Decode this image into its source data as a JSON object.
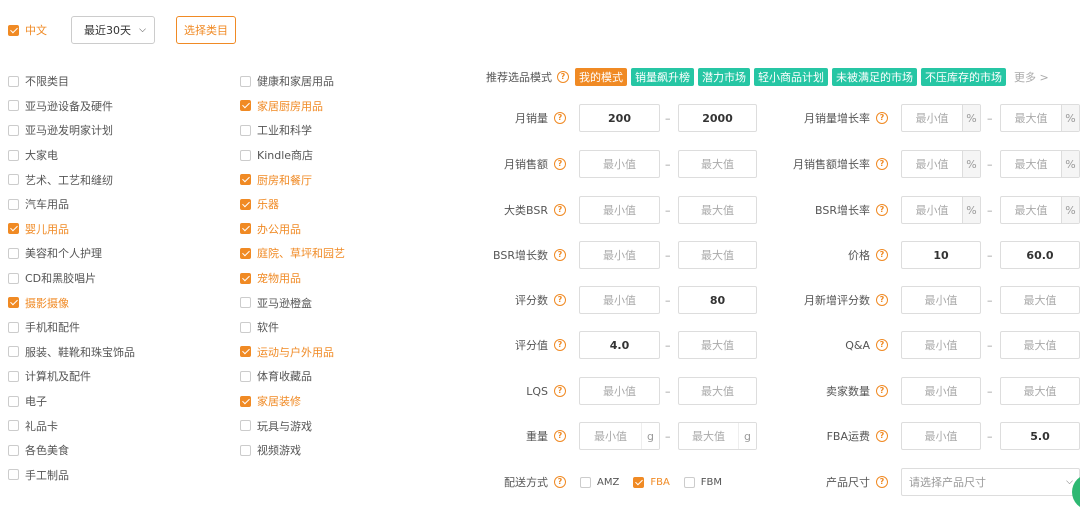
{
  "top": {
    "language_label": "中文",
    "range_value": "最近30天",
    "category_button": "选择类目"
  },
  "categories": {
    "col1": [
      {
        "label": "不限类目",
        "checked": false
      },
      {
        "label": "亚马逊设备及硬件",
        "checked": false
      },
      {
        "label": "亚马逊发明家计划",
        "checked": false
      },
      {
        "label": "大家电",
        "checked": false
      },
      {
        "label": "艺术、工艺和缝纫",
        "checked": false
      },
      {
        "label": "汽车用品",
        "checked": false
      },
      {
        "label": "婴儿用品",
        "checked": true
      },
      {
        "label": "美容和个人护理",
        "checked": false
      },
      {
        "label": "CD和黑胶唱片",
        "checked": false
      },
      {
        "label": "摄影摄像",
        "checked": true
      },
      {
        "label": "手机和配件",
        "checked": false
      },
      {
        "label": "服装、鞋靴和珠宝饰品",
        "checked": false
      },
      {
        "label": "计算机及配件",
        "checked": false
      },
      {
        "label": "电子",
        "checked": false
      },
      {
        "label": "礼品卡",
        "checked": false
      },
      {
        "label": "各色美食",
        "checked": false
      },
      {
        "label": "手工制品",
        "checked": false
      }
    ],
    "col2": [
      {
        "label": "健康和家居用品",
        "checked": false
      },
      {
        "label": "家居厨房用品",
        "checked": true
      },
      {
        "label": "工业和科学",
        "checked": false
      },
      {
        "label": "Kindle商店",
        "checked": false
      },
      {
        "label": "厨房和餐厅",
        "checked": true
      },
      {
        "label": "乐器",
        "checked": true
      },
      {
        "label": "办公用品",
        "checked": true
      },
      {
        "label": "庭院、草坪和园艺",
        "checked": true
      },
      {
        "label": "宠物用品",
        "checked": true
      },
      {
        "label": "亚马逊橙盒",
        "checked": false
      },
      {
        "label": "软件",
        "checked": false
      },
      {
        "label": "运动与户外用品",
        "checked": true
      },
      {
        "label": "体育收藏品",
        "checked": false
      },
      {
        "label": "家居装修",
        "checked": true
      },
      {
        "label": "玩具与游戏",
        "checked": false
      },
      {
        "label": "视频游戏",
        "checked": false
      }
    ]
  },
  "modes": {
    "label": "推荐选品模式",
    "items": [
      "我的模式",
      "销量飙升榜",
      "潜力市场",
      "轻小商品计划",
      "未被满足的市场",
      "不压库存的市场"
    ],
    "more": "更多 >"
  },
  "filters": {
    "monthly_sales": {
      "label": "月销量",
      "min": "200",
      "max": "2000"
    },
    "monthly_revenue": {
      "label": "月销售额",
      "min": "最小值",
      "max": "最大值"
    },
    "category_bsr": {
      "label": "大类BSR",
      "min": "最小值",
      "max": "最大值"
    },
    "bsr_growth_count": {
      "label": "BSR增长数",
      "min": "最小值",
      "max": "最大值"
    },
    "review_count": {
      "label": "评分数",
      "min": "最小值",
      "max": "80"
    },
    "rating": {
      "label": "评分值",
      "min": "4.0",
      "max": "最大值"
    },
    "lqs": {
      "label": "LQS",
      "min": "最小值",
      "max": "最大值"
    },
    "weight": {
      "label": "重量",
      "min": "最小值",
      "max": "最大值",
      "unit": "g"
    },
    "sales_growth_rate": {
      "label": "月销量增长率",
      "min": "最小值",
      "max": "最大值",
      "unit": "%"
    },
    "revenue_growth_rate": {
      "label": "月销售额增长率",
      "min": "最小值",
      "max": "最大值",
      "unit": "%"
    },
    "bsr_growth_rate": {
      "label": "BSR增长率",
      "min": "最小值",
      "max": "最大值",
      "unit": "%"
    },
    "price": {
      "label": "价格",
      "min": "10",
      "max": "60.0"
    },
    "new_reviews_monthly": {
      "label": "月新增评分数",
      "min": "最小值",
      "max": "最大值"
    },
    "qa": {
      "label": "Q&A",
      "min": "最小值",
      "max": "最大值"
    },
    "seller_count": {
      "label": "卖家数量",
      "min": "最小值",
      "max": "最大值"
    },
    "fba_fee": {
      "label": "FBA运费",
      "min": "最小值",
      "max": "5.0"
    }
  },
  "shipping": {
    "label": "配送方式",
    "options": [
      {
        "label": "AMZ",
        "checked": false
      },
      {
        "label": "FBA",
        "checked": true
      },
      {
        "label": "FBM",
        "checked": false
      }
    ]
  },
  "product_size": {
    "label": "产品尺寸",
    "placeholder": "请选择产品尺寸"
  },
  "colors": {
    "accent": "#f08a24",
    "tag_green": "#26c6a4",
    "fab_green": "#2eb872"
  }
}
